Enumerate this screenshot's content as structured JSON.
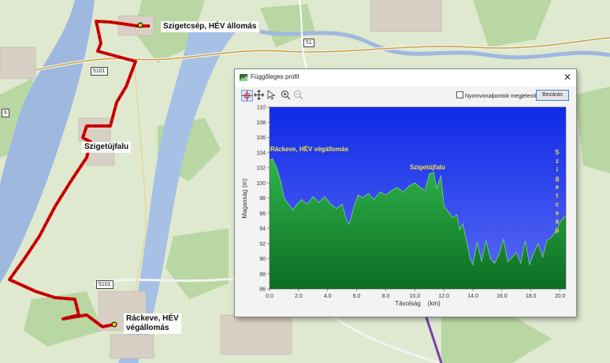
{
  "map": {
    "route_labels": [
      {
        "name": "szigetcsep-label",
        "text": "Szigetcsép, HÉV állomás"
      },
      {
        "name": "szigetujfalu-label",
        "text": "Szigetújfalu"
      },
      {
        "name": "rackeve-label",
        "text": "Ráckeve, HÉV\nvégállomás"
      }
    ],
    "road_numbers": [
      "5101",
      "51",
      "5101",
      "6"
    ],
    "colors": {
      "route": "#d40000",
      "river": "#9fb8e0",
      "land": "#dfe9cf",
      "forest": "#b9d7a2"
    }
  },
  "dialog": {
    "title": "Függőleges profil",
    "close_icon": "close-icon",
    "toolbar": {
      "tools": [
        "crosshair-select-icon",
        "pan-icon",
        "select-arrow-icon",
        "zoom-in-icon",
        "zoom-out-icon"
      ],
      "checkbox_label": "Nyomvonalpontok megjelenítése",
      "checkbox_checked": false,
      "close_button": "Bezárás"
    }
  },
  "chart_data": {
    "type": "area",
    "title": "",
    "xlabel": "Távolság    (km)",
    "ylabel": "Magasság  (m)",
    "xlim": [
      0,
      20.4
    ],
    "ylim": [
      86,
      110
    ],
    "xticks": [
      "0.0",
      "2.0",
      "4.0",
      "6.0",
      "8.0",
      "10.0",
      "12.0",
      "14.0",
      "16.0",
      "18.0",
      "20.0"
    ],
    "yticks": [
      "86",
      "88",
      "90",
      "92",
      "94",
      "96",
      "98",
      "100",
      "102",
      "104",
      "106",
      "108",
      "110"
    ],
    "grid": false,
    "colors": {
      "sky": "#1a34e6",
      "fill": "#1f9a3a"
    },
    "annotations": [
      {
        "text": "Ráckeve, HÉV végállomás",
        "x": 0.05,
        "y": 104.2
      },
      {
        "text": "Szigetújfalu",
        "x": 10.2,
        "y": 101.8
      },
      {
        "text": "Szigetcsép",
        "x": 19.8,
        "y": 95,
        "vertical": true
      }
    ],
    "series": [
      {
        "x": [
          0,
          0.2,
          0.5,
          0.8,
          1.0,
          1.3,
          1.6,
          1.9,
          2.2,
          2.6,
          3.0,
          3.4,
          3.8,
          4.2,
          4.6,
          5.0,
          5.3,
          5.5,
          5.8,
          6.1,
          6.4,
          6.8,
          7.2,
          7.6,
          8.0,
          8.4,
          8.8,
          9.2,
          9.6,
          10.0,
          10.4,
          10.7,
          11.0,
          11.3,
          11.5,
          11.8,
          12.0,
          12.3,
          12.6,
          12.9,
          13.1,
          13.3,
          13.6,
          13.8,
          14.0,
          14.3,
          14.6,
          14.9,
          15.2,
          15.5,
          15.8,
          16.1,
          16.4,
          16.7,
          17.0,
          17.3,
          17.6,
          17.9,
          18.2,
          18.5,
          18.8,
          19.1,
          19.4,
          19.7,
          20.0,
          20.2,
          20.4
        ],
        "y": [
          103.0,
          103.2,
          102.0,
          100.0,
          98.0,
          97.2,
          96.4,
          97.2,
          97.8,
          97.2,
          98.2,
          97.4,
          98.2,
          97.2,
          96.6,
          97.2,
          95.0,
          94.6,
          96.8,
          98.4,
          98.0,
          98.6,
          97.8,
          98.8,
          98.4,
          99.0,
          99.4,
          98.8,
          99.6,
          100.0,
          99.4,
          99.0,
          101.2,
          101.4,
          99.2,
          101.0,
          97.0,
          96.2,
          95.4,
          95.8,
          93.8,
          94.6,
          92.0,
          90.0,
          89.2,
          92.2,
          89.6,
          92.4,
          90.0,
          89.4,
          90.6,
          92.6,
          89.6,
          90.2,
          90.8,
          89.4,
          92.4,
          89.2,
          90.8,
          92.0,
          90.2,
          92.4,
          92.8,
          93.6,
          94.8,
          95.4,
          95.6
        ]
      }
    ]
  }
}
